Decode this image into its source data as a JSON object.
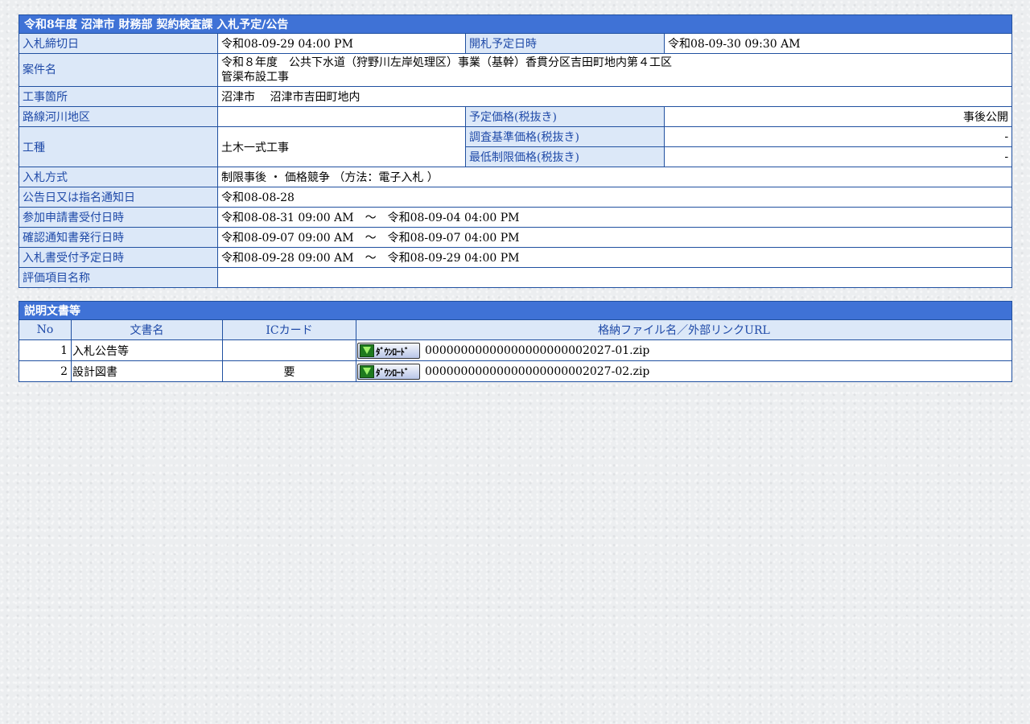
{
  "section1": {
    "title": "令和8年度 沼津市 財務部 契約検査課 入札予定/公告",
    "bid_deadline_label": "入札締切日",
    "bid_deadline": "令和08-09-29 04:00 PM",
    "opening_label": "開札予定日時",
    "opening": "令和08-09-30 09:30 AM",
    "case_name_label": "案件名",
    "case_name_line1": "令和８年度　公共下水道（狩野川左岸処理区）事業（基幹）香貫分区吉田町地内第４工区",
    "case_name_line2": "管渠布設工事",
    "site_label": "工事箇所",
    "site": "沼津市　 沼津市吉田町地内",
    "route_label": "路線河川地区",
    "route": "",
    "planned_price_label": "予定価格(税抜き)",
    "planned_price": "事後公開",
    "work_type_label": "工種",
    "work_type": "土木一式工事",
    "survey_price_label": "調査基準価格(税抜き)",
    "survey_price": "-",
    "min_price_label": "最低制限価格(税抜き)",
    "min_price": "-",
    "bid_method_label": "入札方式",
    "bid_method": "制限事後 ・ 価格競争 （方法：電子入札 ）",
    "notice_date_label": "公告日又は指名通知日",
    "notice_date": "令和08-08-28",
    "application_label": "参加申請書受付日時",
    "application": "令和08-08-31 09:00 AM　～　令和08-09-04 04:00 PM",
    "confirm_label": "確認通知書発行日時",
    "confirm": "令和08-09-07 09:00 AM　～　令和08-09-07 04:00 PM",
    "receipt_label": "入札書受付予定日時",
    "receipt": "令和08-09-28 09:00 AM　～　令和08-09-29 04:00 PM",
    "eval_label": "評価項目名称",
    "eval": ""
  },
  "section2": {
    "title": "説明文書等",
    "headers": [
      "No",
      "文書名",
      "ICカード",
      "格納ファイル名／外部リンクURL"
    ],
    "download_label": "ﾀﾞｳﾝﾛｰﾄﾞ",
    "rows": [
      {
        "no": "1",
        "name": "入札公告等",
        "ic": "",
        "file": "00000000000000000000002027-01.zip"
      },
      {
        "no": "2",
        "name": "設計図書",
        "ic": "要",
        "file": "00000000000000000000002027-02.zip"
      }
    ]
  }
}
